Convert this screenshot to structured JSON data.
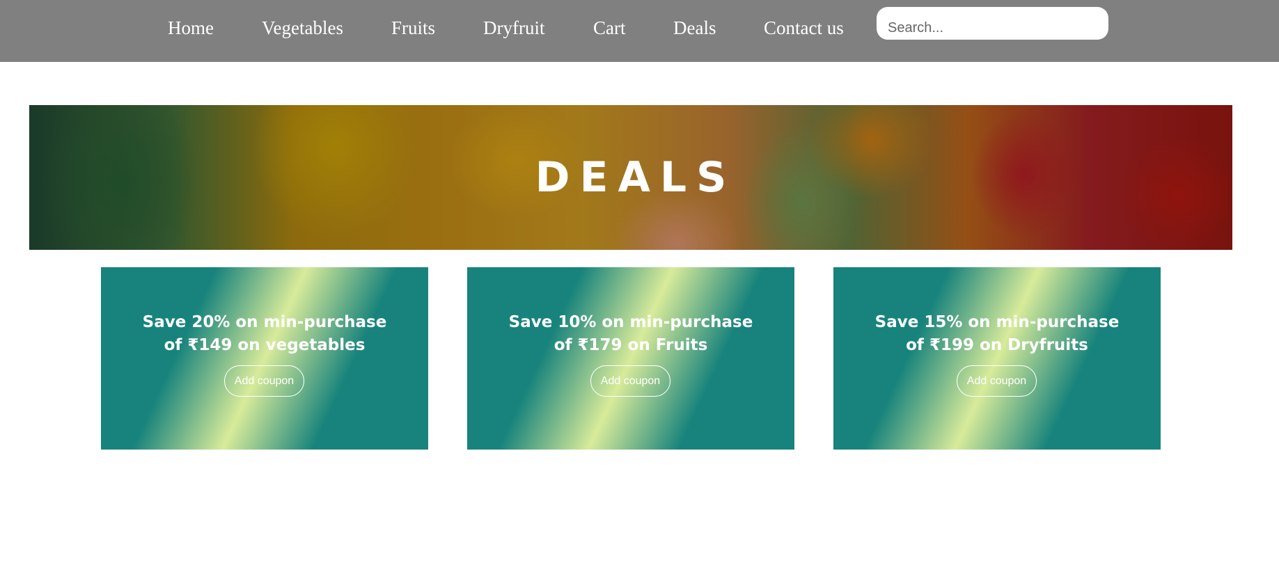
{
  "nav": {
    "items": [
      {
        "label": "Home"
      },
      {
        "label": "Vegetables"
      },
      {
        "label": "Fruits"
      },
      {
        "label": "Dryfruit"
      },
      {
        "label": "Cart"
      },
      {
        "label": "Deals"
      },
      {
        "label": "Contact us"
      }
    ],
    "search_placeholder": "Search..."
  },
  "hero": {
    "title": "DEALS"
  },
  "deals": [
    {
      "line1": "Save 20% on min-purchase",
      "line2": "of ₹149 on vegetables",
      "button": "Add coupon"
    },
    {
      "line1": "Save 10% on min-purchase",
      "line2": "of ₹179 on Fruits",
      "button": "Add coupon"
    },
    {
      "line1": "Save 15% on min-purchase",
      "line2": "of ₹199 on Dryfruits",
      "button": "Add coupon"
    }
  ],
  "colors": {
    "navbar": "#808080",
    "card_teal": "#17837c",
    "card_highlight": "#d8eb9a"
  }
}
